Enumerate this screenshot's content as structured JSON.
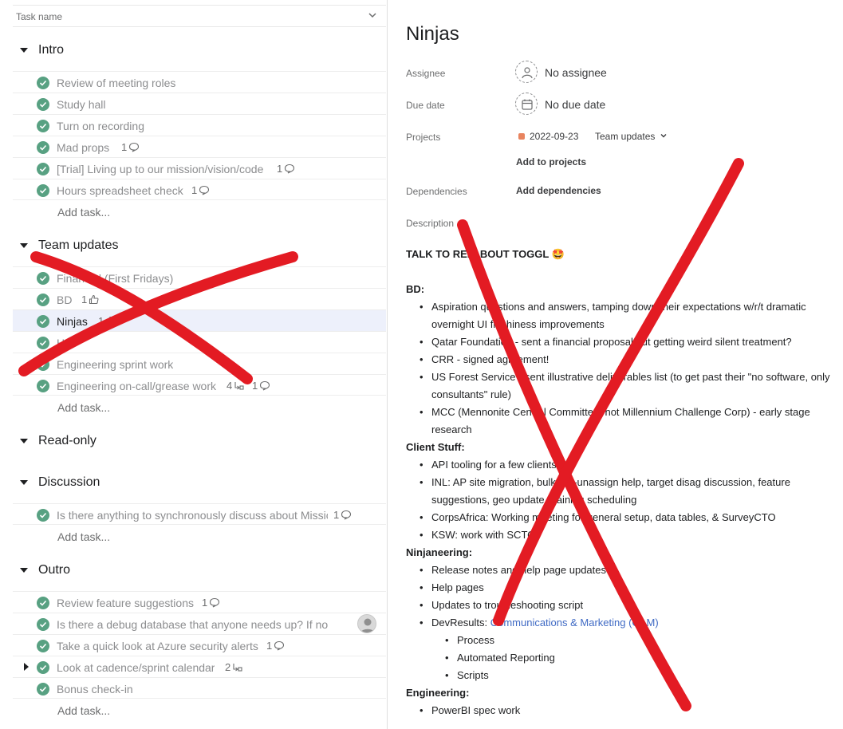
{
  "left": {
    "column_header": "Task name",
    "sections": [
      {
        "title": "Intro",
        "tasks": [
          {
            "name": "Review of meeting roles",
            "meta": ""
          },
          {
            "name": "Study hall",
            "meta": ""
          },
          {
            "name": "Turn on recording",
            "meta": ""
          },
          {
            "name": "Mad props",
            "meta": "1"
          },
          {
            "name": "[Trial] Living up to our mission/vision/code",
            "meta": "1"
          },
          {
            "name": "Hours spreadsheet check",
            "meta": "1"
          }
        ],
        "add_task": "Add task..."
      },
      {
        "title": "Team updates",
        "tasks": [
          {
            "name": "Financial (First Fridays)",
            "meta": ""
          },
          {
            "name": "BD",
            "meta": "1"
          },
          {
            "name": "Ninjas",
            "meta": "1"
          },
          {
            "name": "He",
            "meta": ""
          },
          {
            "name": "Engineering sprint work",
            "meta": ""
          },
          {
            "name": "Engineering on-call/grease work",
            "meta_a": "4",
            "meta_b": "1"
          }
        ],
        "add_task": "Add task..."
      },
      {
        "title": "Read-only",
        "tasks": []
      },
      {
        "title": "Discussion",
        "tasks": [
          {
            "name": "Is there anything to synchronously discuss about Missic",
            "meta": "1"
          }
        ],
        "add_task": "Add task..."
      },
      {
        "title": "Outro",
        "tasks": [
          {
            "name": "Review feature suggestions",
            "meta": "1"
          },
          {
            "name": "Is there a debug database that anyone needs up? If no",
            "meta": ""
          },
          {
            "name": "Take a quick look at Azure security alerts",
            "meta": "1"
          },
          {
            "name": "Look at cadence/sprint calendar",
            "meta": "2"
          },
          {
            "name": "Bonus check-in",
            "meta": ""
          }
        ],
        "add_task": "Add task..."
      }
    ]
  },
  "detail": {
    "title": "Ninjas",
    "assignee_label": "Assignee",
    "assignee_value": "No assignee",
    "due_label": "Due date",
    "due_value": "No due date",
    "projects_label": "Projects",
    "project_date": "2022-09-23",
    "project_name": "Team updates",
    "add_to_projects": "Add to projects",
    "dependencies_label": "Dependencies",
    "add_dependencies": "Add dependencies",
    "description_label": "Description",
    "talk": "TALK TO REI ABOUT TOGGL 🤩",
    "bd_heading": "BD:",
    "bd_items": [
      "Aspiration questions and answers, tamping down their expectations w/r/t dramatic overnight UI flashiness improvements",
      "Qatar Foundation - sent a financial proposal but getting weird silent treatment?",
      "CRR - signed agreement!",
      "US Forest Service - sent illustrative deliverables list (to get past their \"no software, only consultants\" rule)",
      "MCC (Mennonite Central Committee, not Millennium Challenge Corp) - early stage research"
    ],
    "client_heading": "Client Stuff:",
    "client_items": [
      "API tooling for a few clients",
      "INL: AP site migration, bulk UN-unassign help, target disag discussion, feature suggestions, geo update, training scheduling",
      "CorpsAfrica: Working meeting for general setup, data tables, & SurveyCTO",
      "KSW: work with SCTO"
    ],
    "ninja_heading": "Ninjaneering:",
    "ninja_items": [
      "Release notes and help page updates",
      "Help pages",
      "Updates to troubleshooting script"
    ],
    "devresults_prefix": "DevResults: ",
    "devresults_link": "Communications & Marketing (CAM)",
    "devresults_sub": [
      "Process",
      "Automated Reporting",
      "Scripts"
    ],
    "eng_heading": "Engineering:",
    "eng_items": [
      "PowerBI spec work"
    ]
  },
  "colors": {
    "check_green": "#58a182",
    "selected_row": "#edf0fb",
    "red_x": "#e31b23",
    "link_blue": "#3f6ac4",
    "project_swatch": "#e8845f"
  },
  "icons": [
    "chevron-down-icon",
    "check-circle-icon",
    "comment-icon",
    "thumbs-up-icon",
    "subtask-icon",
    "person-icon",
    "calendar-icon"
  ]
}
